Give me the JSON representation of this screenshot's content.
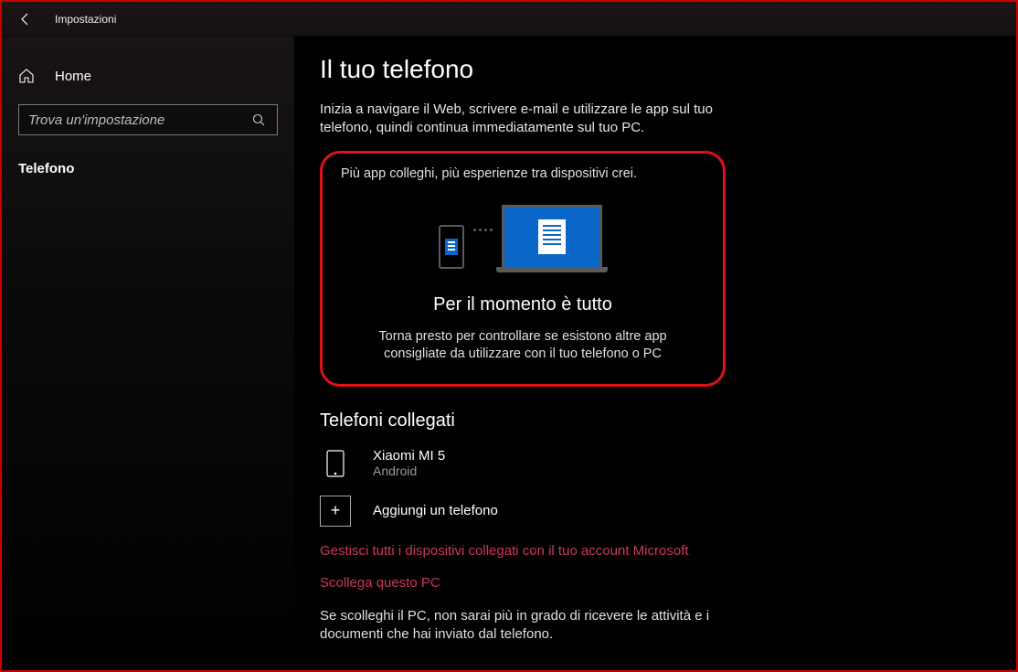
{
  "titlebar": {
    "title": "Impostazioni"
  },
  "sidebar": {
    "home_label": "Home",
    "search_placeholder": "Trova un'impostazione",
    "category_label": "Telefono"
  },
  "main": {
    "page_title": "Il tuo telefono",
    "intro": "Inizia a navigare il Web, scrivere e-mail e utilizzare le app sul tuo telefono, quindi continua immediatamente sul tuo PC.",
    "highlight": {
      "lead": "Più app colleghi, più esperienze tra dispositivi crei.",
      "title": "Per il momento è tutto",
      "sub": "Torna presto per controllare se esistono altre app consigliate da utilizzare con il tuo telefono o PC"
    },
    "linked_title": "Telefoni collegati",
    "device": {
      "name": "Xiaomi MI 5",
      "platform": "Android"
    },
    "add_phone": "Aggiungi un telefono",
    "manage_link": "Gestisci tutti i dispositivi collegati con il tuo account Microsoft",
    "unlink_link": "Scollega questo PC",
    "unlink_desc": "Se scolleghi il PC, non sarai più in grado di ricevere le attività e i documenti che hai inviato dal telefono."
  }
}
